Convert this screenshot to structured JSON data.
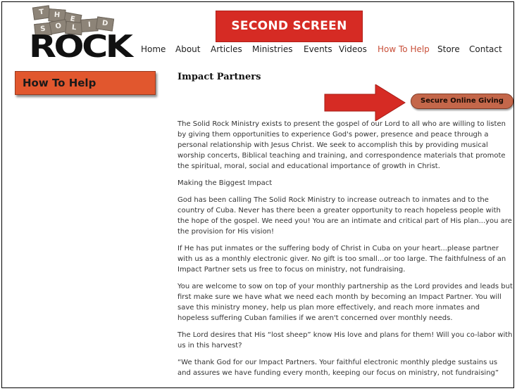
{
  "logo": {
    "tiles": [
      "T",
      "H",
      "E",
      "S",
      "O",
      "L",
      "I",
      "D"
    ],
    "wordmark": "ROCK"
  },
  "nav": {
    "items": [
      {
        "label": "Home"
      },
      {
        "label": "About"
      },
      {
        "label": "Articles"
      },
      {
        "label": "Ministries"
      },
      {
        "label": "Events"
      },
      {
        "label": "Videos"
      },
      {
        "label": "How To Help"
      },
      {
        "label": "Store"
      },
      {
        "label": "Contact"
      }
    ],
    "active_color": "#c9503a"
  },
  "banner": {
    "text": "SECOND SCREEN",
    "color": "#d62b24"
  },
  "sidebar": {
    "heading": "How To Help",
    "color": "#e1572e"
  },
  "main": {
    "title": "Impact Partners",
    "give_button": "Secure Online Giving",
    "paragraphs": [
      "The Solid Rock Ministry exists to present the gospel of our Lord to all who are willing to listen by giving them opportunities to experience God's power, presence and peace through a personal relationship with Jesus Christ.  We seek to accomplish this by providing musical worship concerts, Biblical teaching and training, and correspondence materials that promote the spiritual, moral, social and educational importance of growth in Christ.",
      "Making the Biggest Impact",
      "God has been calling The Solid Rock Ministry to increase outreach to inmates and to the country of Cuba. Never has there been a greater opportunity to reach hopeless people with the hope of the gospel. We need you! You are an intimate and critical part of His plan...you are the provision for His vision!",
      "If He has put inmates or the suffering body of Christ in Cuba on your heart...please partner with us as a monthly electronic giver.  No gift is too small...or too large.  The faithfulness of an Impact Partner sets us free to focus on ministry, not fundraising.",
      "You are welcome to sow on top of your monthly partnership as the Lord provides and leads but first make sure we have what we need each month by becoming an Impact Partner.  You will save this ministry money, help us plan more effectively, and reach more inmates and hopeless suffering Cuban families if we aren't concerned over monthly needs.",
      "The Lord desires that His “lost sheep” know His love and plans for them! Will you co-labor with us in this harvest?",
      "“We thank God for our Impact Partners.  Your faithful electronic monthly pledge sustains us and assures we have funding every month, keeping our focus on ministry, not fundraising”"
    ]
  }
}
